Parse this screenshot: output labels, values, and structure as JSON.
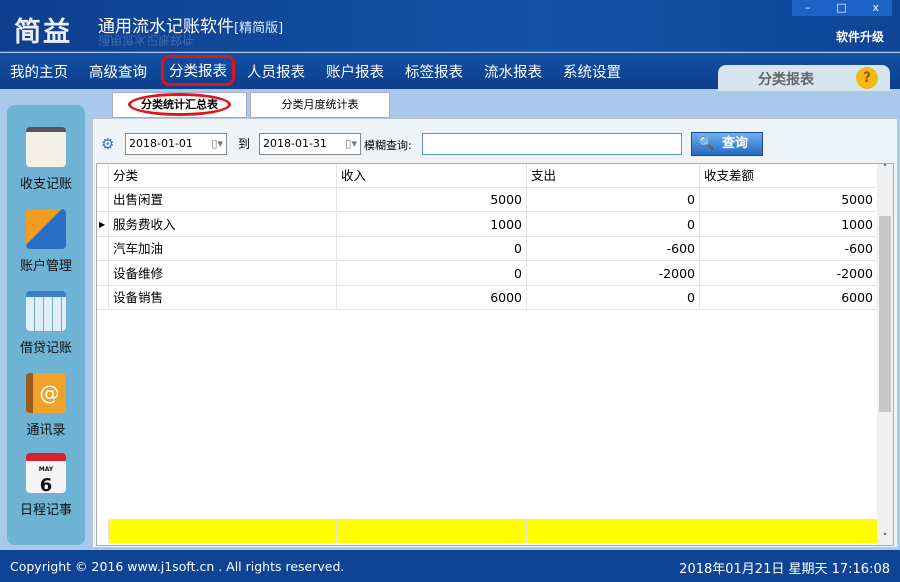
{
  "app": {
    "logo": "简益",
    "title": "通用流水记账软件",
    "edition": "[精简版]",
    "upgrade": "软件升级",
    "window_controls": [
      "–",
      "□",
      "x"
    ]
  },
  "nav": {
    "items": [
      "我的主页",
      "高级查询",
      "分类报表",
      "人员报表",
      "账户报表",
      "标签报表",
      "流水报表",
      "系统设置"
    ],
    "active": "分类报表"
  },
  "page_tab": {
    "label": "分类报表",
    "help": "?"
  },
  "sidebar": {
    "items": [
      "收支记账",
      "账户管理",
      "借贷记账",
      "通讯录",
      "日程记事"
    ],
    "calendar_month": "MAY",
    "calendar_day": "6"
  },
  "tabs": [
    "分类统计汇总表",
    "分类月度统计表"
  ],
  "toolbar": {
    "start_date": "2018-01-01",
    "to_label": "到",
    "end_date": "2018-01-31",
    "search_label": "模糊查询:",
    "search_value": "",
    "query_button": "查询"
  },
  "table": {
    "columns": [
      "分类",
      "收入",
      "支出",
      "收支差额"
    ],
    "rows": [
      [
        "出售闲置",
        "5000",
        "0",
        "5000"
      ],
      [
        "服务费收入",
        "1000",
        "0",
        "1000"
      ],
      [
        "汽车加油",
        "0",
        "-600",
        "-600"
      ],
      [
        "设备维修",
        "0",
        "-2000",
        "-2000"
      ],
      [
        "设备销售",
        "6000",
        "0",
        "6000"
      ]
    ],
    "current_row": 1
  },
  "footer": {
    "copyright": "Copyright © 2016 www.j1soft.cn . All rights reserved.",
    "datetime": "2018年01月21日  星期天 17:16:08"
  }
}
